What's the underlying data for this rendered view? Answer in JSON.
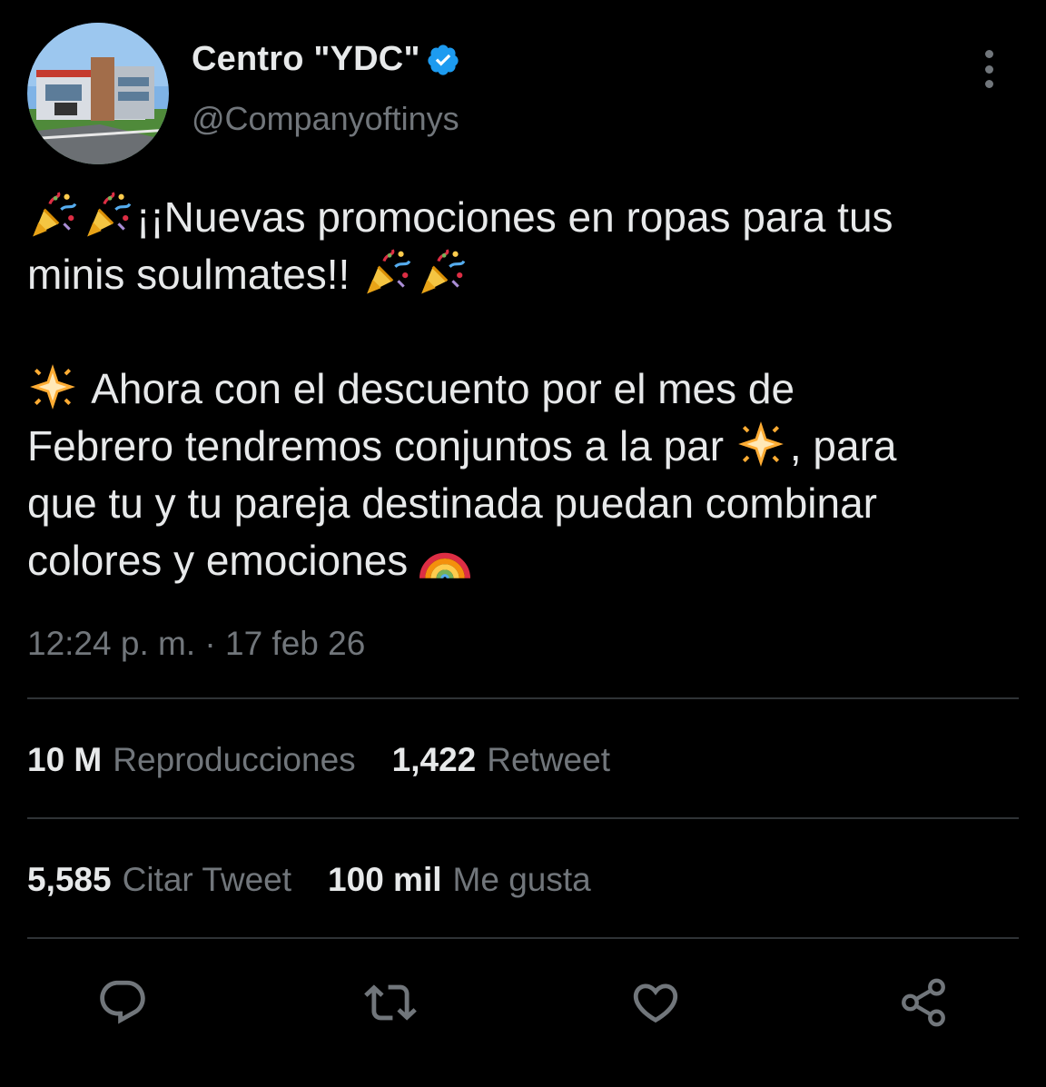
{
  "author": {
    "name": "Centro \"YDC\"",
    "handle": "@Companyoftinys",
    "verified": true
  },
  "tweet": {
    "lines": [
      "¡¡Nuevas promociones en ropas para tus",
      "minis soulmates!!",
      "Ahora con el descuento por el mes de",
      "Febrero tendremos conjuntos a la par",
      ", para",
      "que tu y tu pareja destinada puedan combinar",
      "colores y emociones"
    ],
    "emojis": [
      "party-popper",
      "glowing-star",
      "rainbow"
    ]
  },
  "timestamp": "12:24 p. m. · 17 feb 26",
  "stats": {
    "views_count": "10 M",
    "views_label": "Reproducciones",
    "retweets_count": "1,422",
    "retweets_label": "Retweet",
    "quotes_count": "5,585",
    "quotes_label": "Citar Tweet",
    "likes_count": "100 mil",
    "likes_label": "Me gusta"
  },
  "actions": [
    "reply-icon",
    "retweet-icon",
    "like-icon",
    "share-icon"
  ],
  "colors": {
    "background": "#000000",
    "text": "#e7e9ea",
    "secondary": "#71767b",
    "divider": "#2f3336",
    "verified": "#1d9bf0"
  }
}
